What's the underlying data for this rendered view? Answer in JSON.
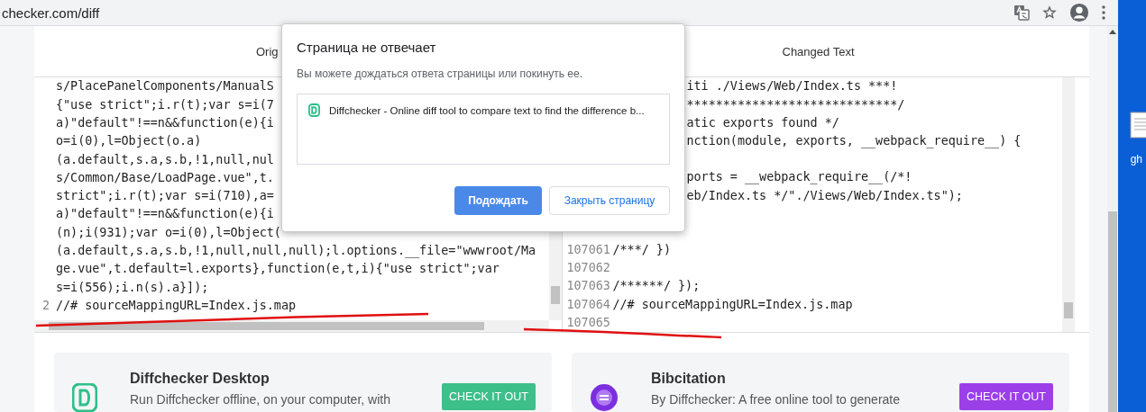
{
  "browser": {
    "url": "checker.com/diff"
  },
  "panels": [
    {
      "title": "Orig",
      "lines": [
        {
          "text": "s/PlacePanelComponents/ManualS"
        },
        {
          "text": "{\"use strict\";i.r(t);var s=i(7"
        },
        {
          "text": "a)\"default\"!==n&&function(e){i"
        },
        {
          "text": "o=i(0),l=Object(o.a)"
        },
        {
          "text": "(a.default,s.a,s.b,!1,null,nul"
        },
        {
          "text": "s/Common/Base/LoadPage.vue\",t."
        },
        {
          "text": "strict\";i.r(t);var s=i(710),a="
        },
        {
          "text": "a)\"default\"!==n&&function(e){i"
        },
        {
          "text": "(n);i(931);var o=i(0),l=Object("
        },
        {
          "text": "(a.default,s.a,s.b,!1,null,null,null);l.options.__file=\"wwwroot/Ma"
        },
        {
          "text": "ge.vue\",t.default=l.exports},function(e,t,i){\"use strict\";var"
        },
        {
          "text": "s=i(556);i.n(s).a}]);"
        },
        {
          "number": "2",
          "text": "//# sourceMappingURL=Index.js.map"
        }
      ]
    },
    {
      "title": "Changed Text",
      "lines": [
        {
          "text": "iti ./Views/Web/Index.ts ***!"
        },
        {
          "text": "*****************************/"
        },
        {
          "text": "atic exports found */"
        },
        {
          "text": "nction(module, exports, __webpack_require__) {"
        },
        {
          "kind": "blank"
        },
        {
          "text": "ports = __webpack_require__(/*!"
        },
        {
          "text": "eb/Index.ts */\"./Views/Web/Index.ts\");"
        },
        {
          "kind": "blank"
        },
        {
          "kind": "blank"
        },
        {
          "number": "107061",
          "text": "/***/ })"
        },
        {
          "number": "107062"
        },
        {
          "number": "107063",
          "text": "/******/ });"
        },
        {
          "number": "107064",
          "text": "//# sourceMappingURL=Index.js.map"
        },
        {
          "number": "107065"
        }
      ]
    }
  ],
  "dialog": {
    "title": "Страница не отвечает",
    "message": "Вы можете дождаться ответа страницы или покинуть ее.",
    "pages": [
      "Diffchecker - Online diff tool to compare text to find the difference b..."
    ],
    "buttons": [
      {
        "label": "Подождать",
        "kind": "primary"
      },
      {
        "label": "Закрыть страницу",
        "kind": "secondary"
      }
    ]
  },
  "promos": [
    {
      "title": "Diffchecker Desktop",
      "text": "Run Diffchecker offline, on your computer, with",
      "button": "CHECK IT OUT",
      "kind": "desktop",
      "color": "#3dbf8a"
    },
    {
      "title": "Bibcitation",
      "text": "By Diffchecker: A free online tool to generate",
      "button": "CHECK IT OUT",
      "kind": "bibcitation",
      "color": "#9b3fe8"
    }
  ],
  "desktop": {
    "file_label": "gh"
  }
}
